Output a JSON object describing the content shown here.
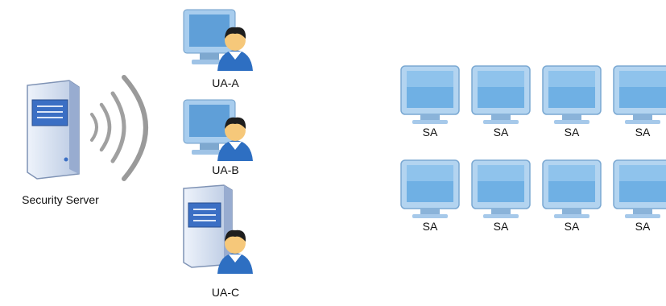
{
  "server": {
    "label": "Security Server",
    "icon": "server-icon"
  },
  "signal": {
    "icon": "wireless-signal-icon"
  },
  "users": [
    {
      "label": "UA-A",
      "icon": "monitor-user-icon"
    },
    {
      "label": "UA-B",
      "icon": "monitor-user-icon"
    },
    {
      "label": "UA-C",
      "icon": "server-user-icon"
    }
  ],
  "agents": [
    {
      "label": "SA"
    },
    {
      "label": "SA"
    },
    {
      "label": "SA"
    },
    {
      "label": "SA"
    },
    {
      "label": "SA"
    },
    {
      "label": "SA"
    },
    {
      "label": "SA"
    },
    {
      "label": "SA"
    }
  ],
  "colors": {
    "server_body": "#c9d6ea",
    "server_panel": "#3b6fc4",
    "monitor_frame": "#9fc6e8",
    "monitor_screen": "#5f9fd8",
    "person_face": "#f6c87a",
    "person_shirt": "#2e6fc2",
    "arc": "#9a9a9a"
  }
}
